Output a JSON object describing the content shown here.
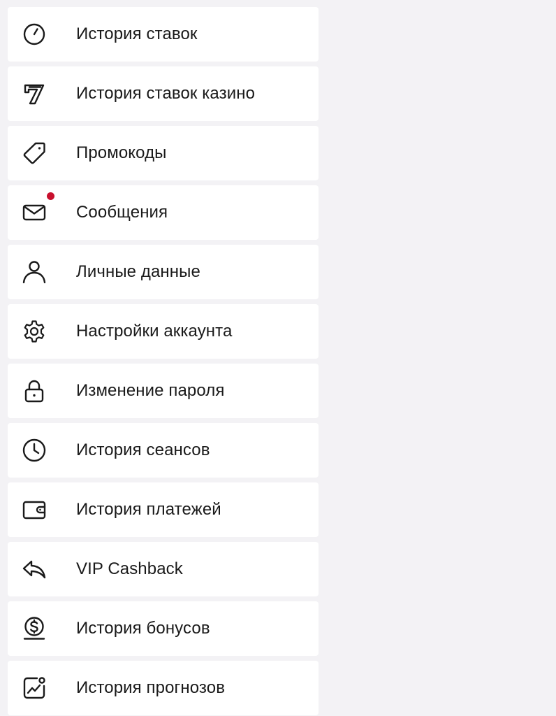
{
  "accent_color": "#c8102e",
  "menu": {
    "items": [
      {
        "label": "История ставок",
        "icon": "stopwatch-icon"
      },
      {
        "label": "История ставок казино",
        "icon": "slot-seven-icon"
      },
      {
        "label": "Промокоды",
        "icon": "tag-icon"
      },
      {
        "label": "Сообщения",
        "icon": "envelope-icon",
        "unread_badge": true
      },
      {
        "label": "Личные данные",
        "icon": "user-icon"
      },
      {
        "label": "Настройки аккаунта",
        "icon": "gear-icon"
      },
      {
        "label": "Изменение пароля",
        "icon": "lock-icon"
      },
      {
        "label": "История сеансов",
        "icon": "clock-icon"
      },
      {
        "label": "История платежей",
        "icon": "wallet-icon"
      },
      {
        "label": "VIP Cashback",
        "icon": "reply-arrow-icon"
      },
      {
        "label": "История бонусов",
        "icon": "dollar-coin-icon"
      },
      {
        "label": "История прогнозов",
        "icon": "trend-chart-icon"
      }
    ]
  }
}
